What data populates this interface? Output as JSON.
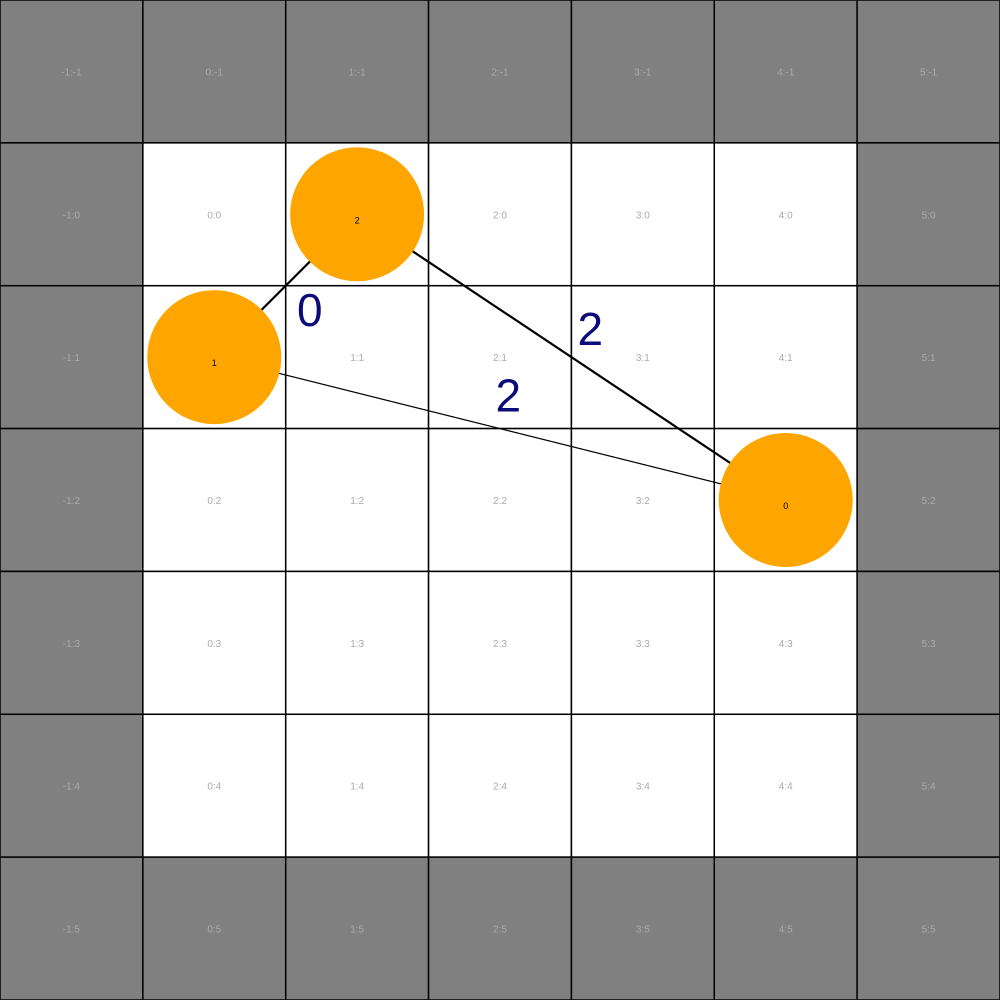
{
  "colors": {
    "wall": "#808080",
    "floor": "#ffffff",
    "grid_line": "#000000",
    "cell_label": "#aaaaaa",
    "node_fill": "#ffa500",
    "edge_stroke": "#000000",
    "edge_label": "#0b0b7a"
  },
  "grid": {
    "columns": [
      -1,
      0,
      1,
      2,
      3,
      4,
      5
    ],
    "rows": [
      -1,
      0,
      1,
      2,
      3,
      4,
      5
    ],
    "walkable_columns": [
      0,
      4
    ],
    "walkable_rows": [
      0,
      4
    ]
  },
  "nodes": [
    {
      "id": "0",
      "label": "0",
      "col": 4,
      "row": 2
    },
    {
      "id": "1",
      "label": "1",
      "col": 0,
      "row": 1
    },
    {
      "id": "2",
      "label": "2",
      "col": 1,
      "row": 0
    }
  ],
  "edges": [
    {
      "from": "1",
      "to": "2",
      "label": "0"
    },
    {
      "from": "2",
      "to": "0",
      "label": "2"
    },
    {
      "from": "1",
      "to": "0",
      "label": "2"
    }
  ]
}
